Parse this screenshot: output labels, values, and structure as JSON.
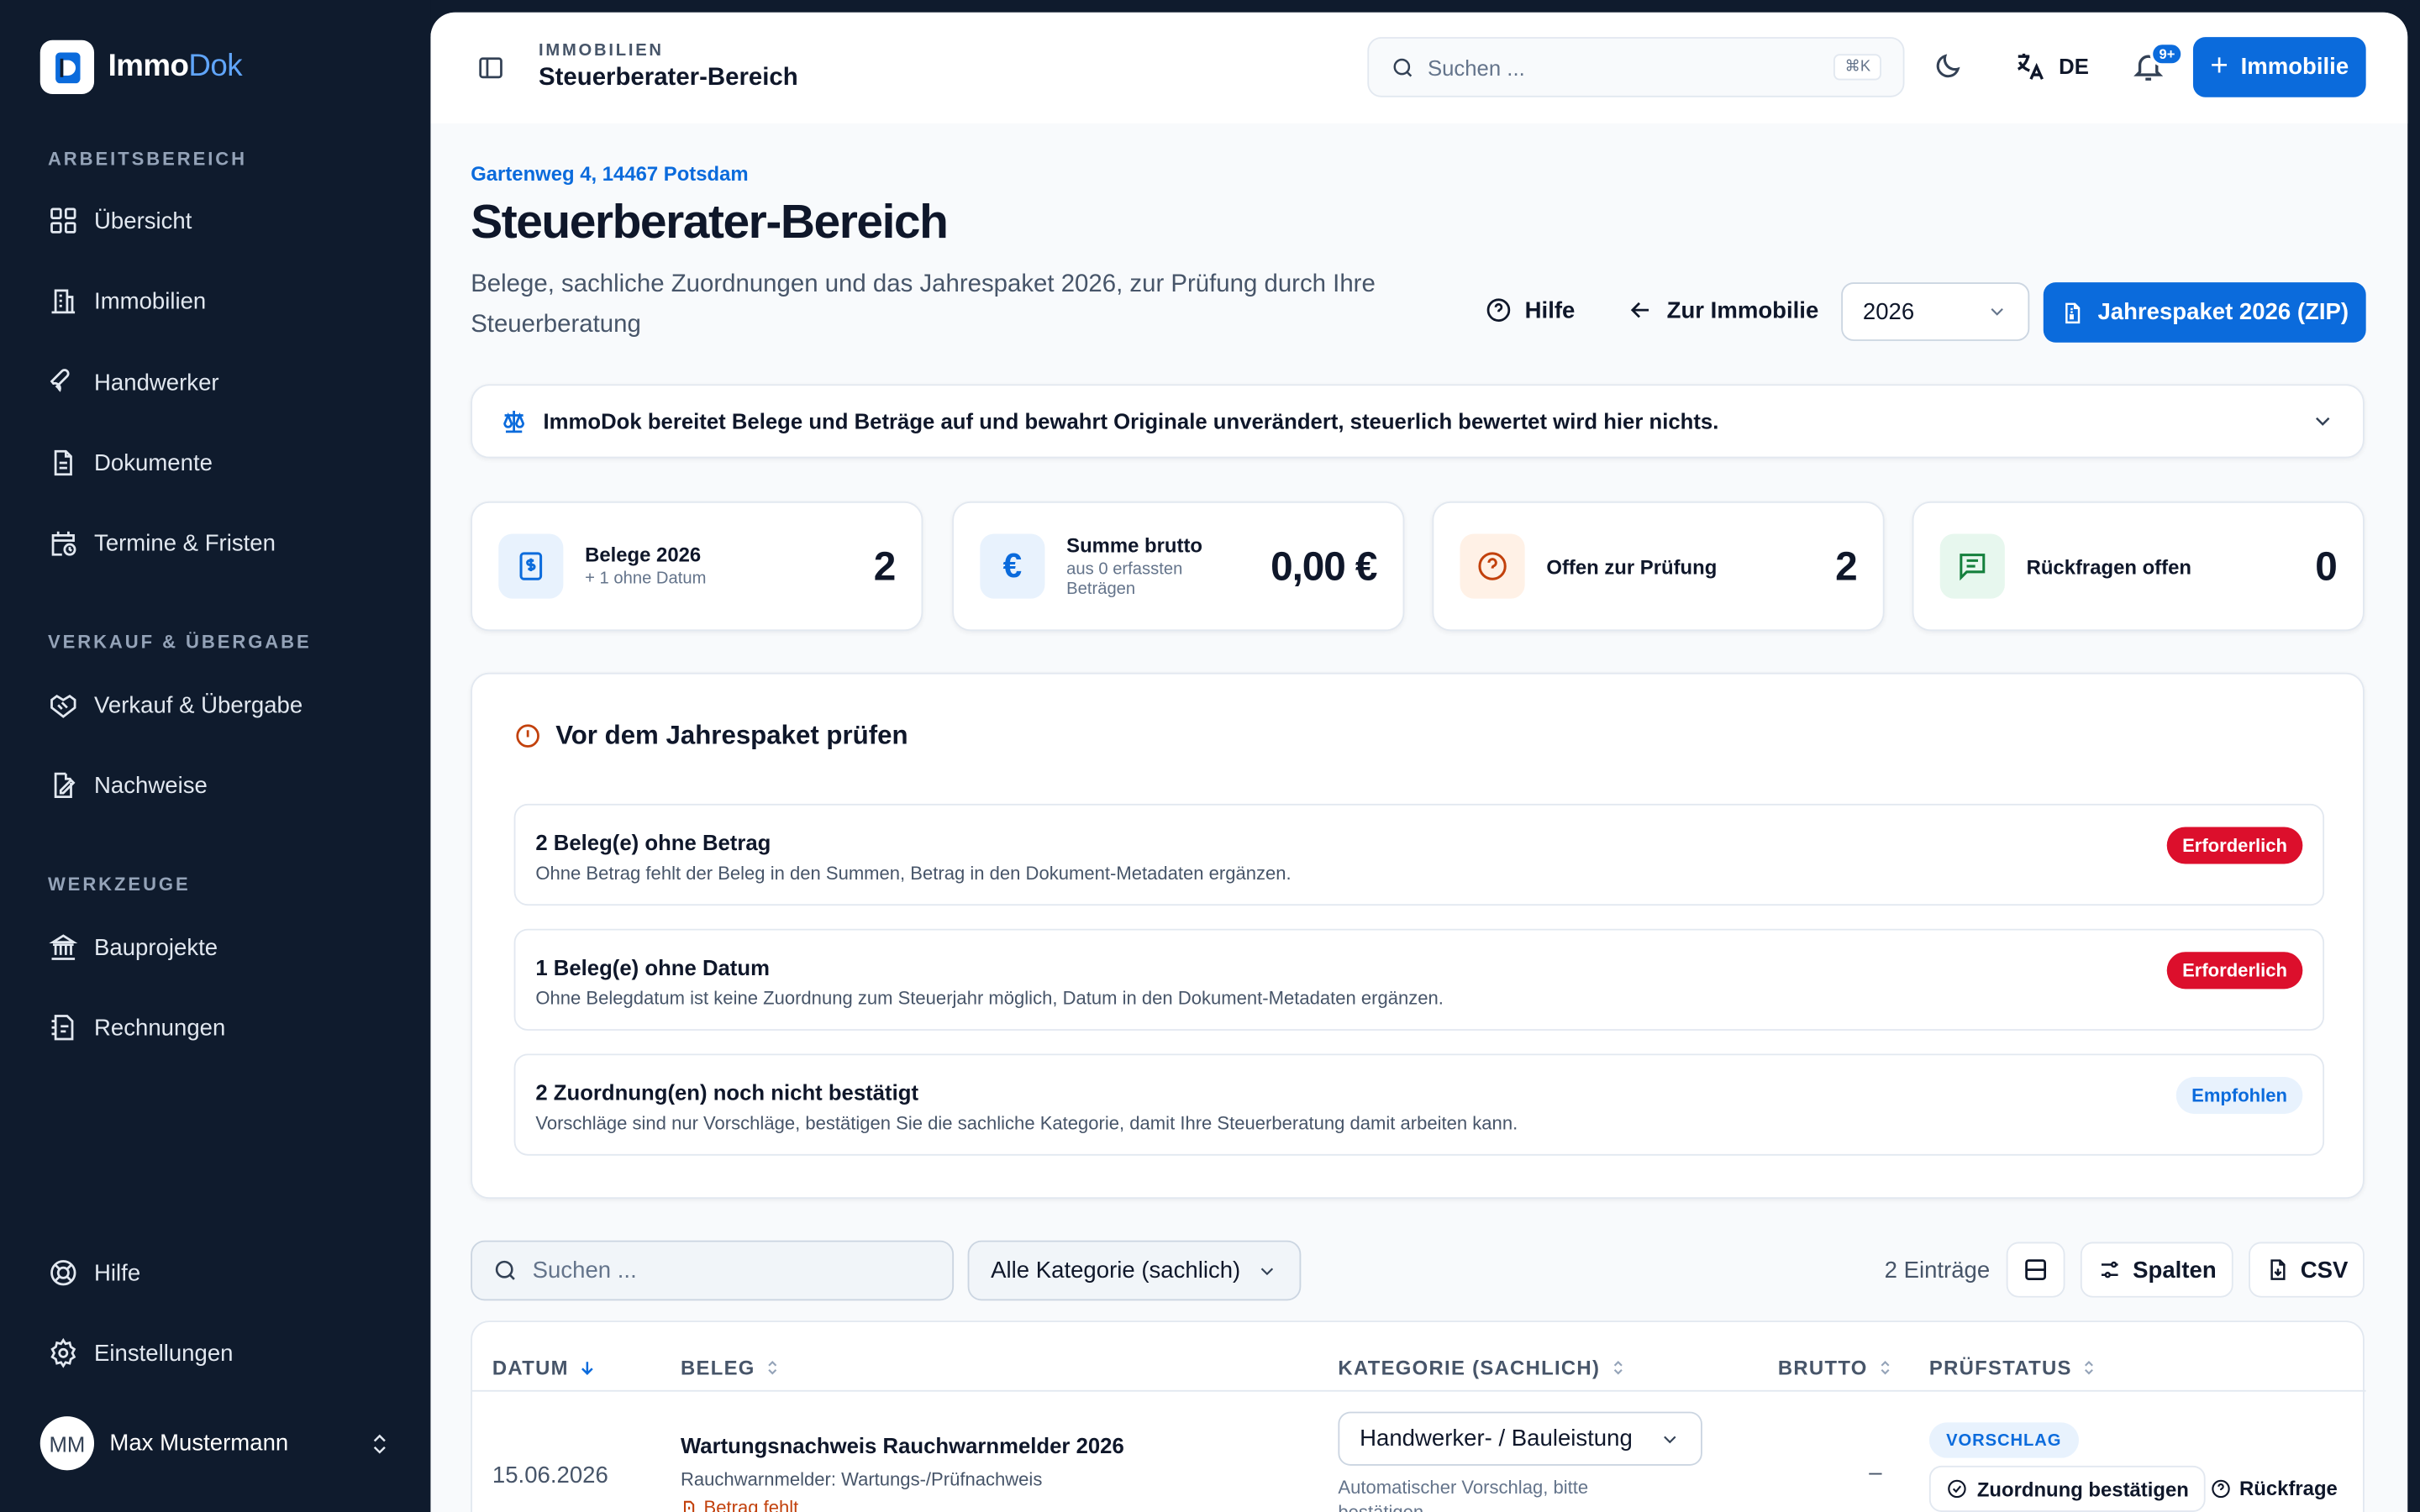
{
  "brand": {
    "name_main": "Immo",
    "name_accent": "Dok"
  },
  "sidebar": {
    "sections": [
      {
        "label": "ARBEITSBEREICH"
      },
      {
        "label": "VERKAUF & ÜBERGABE"
      },
      {
        "label": "WERKZEUGE"
      }
    ],
    "items": [
      {
        "label": "Übersicht",
        "icon": "grid-icon"
      },
      {
        "label": "Immobilien",
        "icon": "building-icon"
      },
      {
        "label": "Handwerker",
        "icon": "wrench-icon"
      },
      {
        "label": "Dokumente",
        "icon": "document-icon"
      },
      {
        "label": "Termine & Fristen",
        "icon": "calendar-clock-icon"
      },
      {
        "label": "Verkauf & Übergabe",
        "icon": "handshake-icon"
      },
      {
        "label": "Nachweise",
        "icon": "file-signature-icon"
      },
      {
        "label": "Bauprojekte",
        "icon": "landmark-icon"
      },
      {
        "label": "Rechnungen",
        "icon": "receipt-icon"
      },
      {
        "label": "Hilfe",
        "icon": "lifebuoy-icon"
      },
      {
        "label": "Einstellungen",
        "icon": "gear-icon"
      }
    ],
    "user": {
      "initials": "MM",
      "name": "Max Mustermann"
    }
  },
  "topbar": {
    "crumb_small": "IMMOBILIEN",
    "crumb_title": "Steuerberater-Bereich",
    "search_placeholder": "Suchen ...",
    "search_kbd": "⌘K",
    "language": "DE",
    "notif_badge": "9+",
    "add_button": "Immobilie"
  },
  "page": {
    "address": "Gartenweg 4, 14467 Potsdam",
    "title": "Steuerberater-Bereich",
    "subtitle": "Belege, sachliche Zuordnungen und das Jahrespaket 2026, zur Prüfung durch Ihre Steuerberatung",
    "help": "Hilfe",
    "back": "Zur Immobilie",
    "year": "2026",
    "export": "Jahrespaket 2026 (ZIP)",
    "notice": "ImmoDok bereitet Belege und Beträge auf und bewahrt Originale unverändert, steuerlich bewertet wird hier nichts."
  },
  "stats": [
    {
      "label": "Belege 2026",
      "note": "+ 1 ohne Datum",
      "value": "2"
    },
    {
      "label": "Summe brutto",
      "note": "aus 0 erfassten Beträgen",
      "value": "0,00 €"
    },
    {
      "label": "Offen zur Prüfung",
      "note": "",
      "value": "2"
    },
    {
      "label": "Rückfragen offen",
      "note": "",
      "value": "0"
    }
  ],
  "checks": {
    "title": "Vor dem Jahrespaket prüfen",
    "rows": [
      {
        "title": "2 Beleg(e) ohne Betrag",
        "desc": "Ohne Betrag fehlt der Beleg in den Summen, Betrag in den Dokument-Metadaten ergänzen.",
        "badge": "Erforderlich"
      },
      {
        "title": "1 Beleg(e) ohne Datum",
        "desc": "Ohne Belegdatum ist keine Zuordnung zum Steuerjahr möglich, Datum in den Dokument-Metadaten ergänzen.",
        "badge": "Erforderlich"
      },
      {
        "title": "2 Zuordnung(en) noch nicht bestätigt",
        "desc": "Vorschläge sind nur Vorschläge, bestätigen Sie die sachliche Kategorie, damit Ihre Steuerberatung damit arbeiten kann.",
        "badge": "Empfohlen"
      }
    ]
  },
  "table": {
    "search_placeholder": "Suchen ...",
    "filter": "Alle Kategorie (sachlich)",
    "count": "2 Einträge",
    "columns_btn": "Spalten",
    "csv_btn": "CSV",
    "headers": [
      "DATUM",
      "BELEG",
      "KATEGORIE (SACHLICH)",
      "BRUTTO",
      "PRÜFSTATUS"
    ],
    "rows": [
      {
        "date": "15.06.2026",
        "title": "Wartungsnachweis Rauchwarnmelder 2026",
        "sub": "Rauchwarnmelder: Wartungs-/Prüfnachweis",
        "warn": "Betrag fehlt",
        "category": "Handwerker- / Bauleistung",
        "category_note": "Automatischer Vorschlag, bitte bestätigen",
        "brutto": "–",
        "status": "VORSCHLAG",
        "action_confirm": "Zuordnung bestätigen",
        "action_query": "Rückfrage"
      }
    ]
  }
}
